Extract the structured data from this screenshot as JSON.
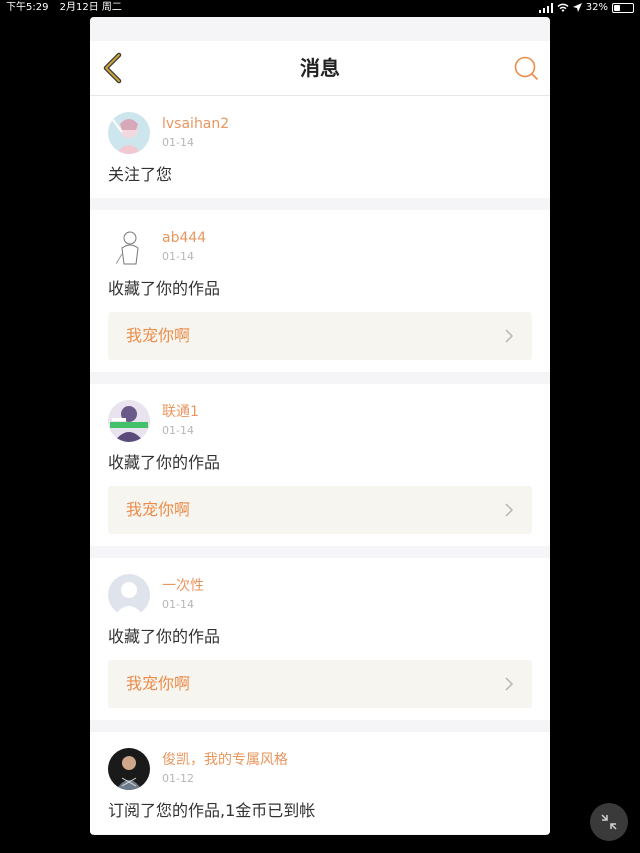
{
  "status_bar": {
    "time": "下午5:29",
    "date": "2月12日 周二",
    "battery": "32%"
  },
  "nav": {
    "title": "消息",
    "back_icon": "chevron-left-icon",
    "search_icon": "search-icon"
  },
  "colors": {
    "accent": "#ec8c4a",
    "username": "#e9965f",
    "work_bg": "#f6f5ef",
    "back_icon": "#c9a23a"
  },
  "messages": [
    {
      "username": "lvsaihan2",
      "date": "01-14",
      "action": "关注了您",
      "work": null
    },
    {
      "username": "ab444",
      "date": "01-14",
      "action": "收藏了你的作品",
      "work": "我宠你啊"
    },
    {
      "username": "联通1",
      "date": "01-14",
      "action": "收藏了你的作品",
      "work": "我宠你啊"
    },
    {
      "username": "一次性",
      "date": "01-14",
      "action": "收藏了你的作品",
      "work": "我宠你啊"
    },
    {
      "username": "俊凯，我的专属风格",
      "date": "01-12",
      "action": "订阅了您的作品,1金币已到帐",
      "work": null
    }
  ]
}
